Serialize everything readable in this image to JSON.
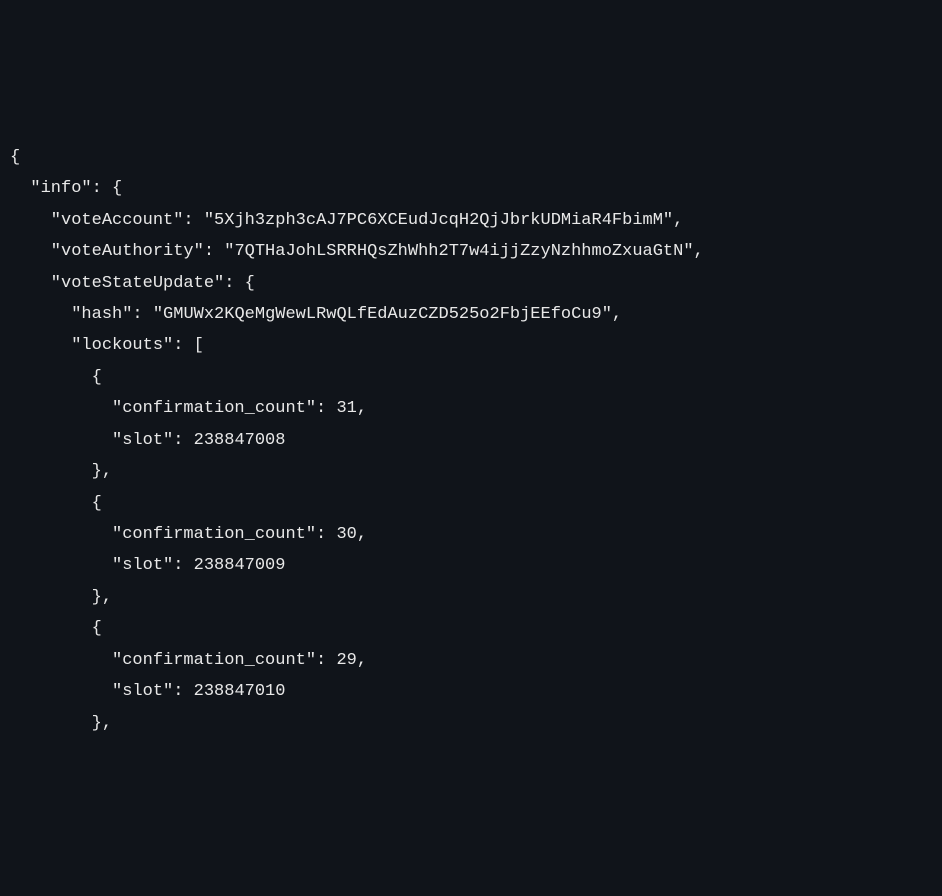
{
  "code": {
    "key_info": "info",
    "key_voteAccount": "voteAccount",
    "val_voteAccount": "5Xjh3zph3cAJ7PC6XCEudJcqH2QjJbrkUDMiaR4FbimM",
    "key_voteAuthority": "voteAuthority",
    "val_voteAuthority": "7QTHaJohLSRRHQsZhWhh2T7w4ijjZzyNzhhmoZxuaGtN",
    "key_voteStateUpdate": "voteStateUpdate",
    "key_hash": "hash",
    "val_hash": "GMUWx2KQeMgWewLRwQLfEdAuzCZD525o2FbjEEfoCu9",
    "key_lockouts": "lockouts",
    "key_confirmation_count": "confirmation_count",
    "key_slot": "slot",
    "lockout0_cc": "31",
    "lockout0_slot": "238847008",
    "lockout1_cc": "30",
    "lockout1_slot": "238847009",
    "lockout2_cc": "29",
    "lockout2_slot": "238847010"
  }
}
